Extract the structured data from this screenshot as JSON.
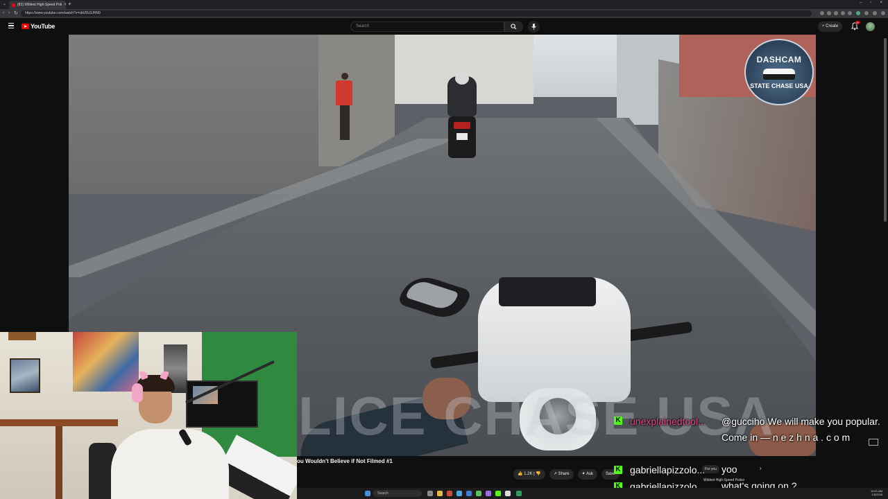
{
  "browser": {
    "tab_title": "(83) Wildest High-Speed Poli",
    "url": "https://www.youtube.com/watch?v=sbU5U3JHN9"
  },
  "youtube": {
    "logo_text": "YouTube",
    "search_placeholder": "Search",
    "create_label": "+ Create",
    "notification_count": "9+"
  },
  "video": {
    "overlay_badge_top": "DASHCAM",
    "overlay_badge_bottom": "STATE CHASE USA",
    "bottom_watermark": "LICE CHASE USA",
    "title": "ou Wouldn't Believe if Not Filmed #1",
    "actions": {
      "like": "1.2K",
      "share": "Share",
      "ask": "Ask",
      "save": "Save"
    },
    "rec_chip": "For you",
    "rec_title": "Wildest High-Speed Police"
  },
  "chat": [
    {
      "user": "unexplainedtool...",
      "color": "#e0457b",
      "text": "@guccih​o We will make you popular. Come in — n e z h n a . c o m"
    },
    {
      "user": "gabriellapizzolo...",
      "color": "#ffffff",
      "text": "yoo"
    },
    {
      "user": "gabriellapizzolo...",
      "color": "#ffffff",
      "text": "what's going on ?"
    }
  ],
  "taskbar": {
    "search_label": "Search",
    "time": "10:21 AM",
    "date": "1/8/2026"
  },
  "colors": {
    "youtube_red": "#ff0000",
    "kick_green": "#53fc18",
    "background": "#0f0f0f"
  }
}
